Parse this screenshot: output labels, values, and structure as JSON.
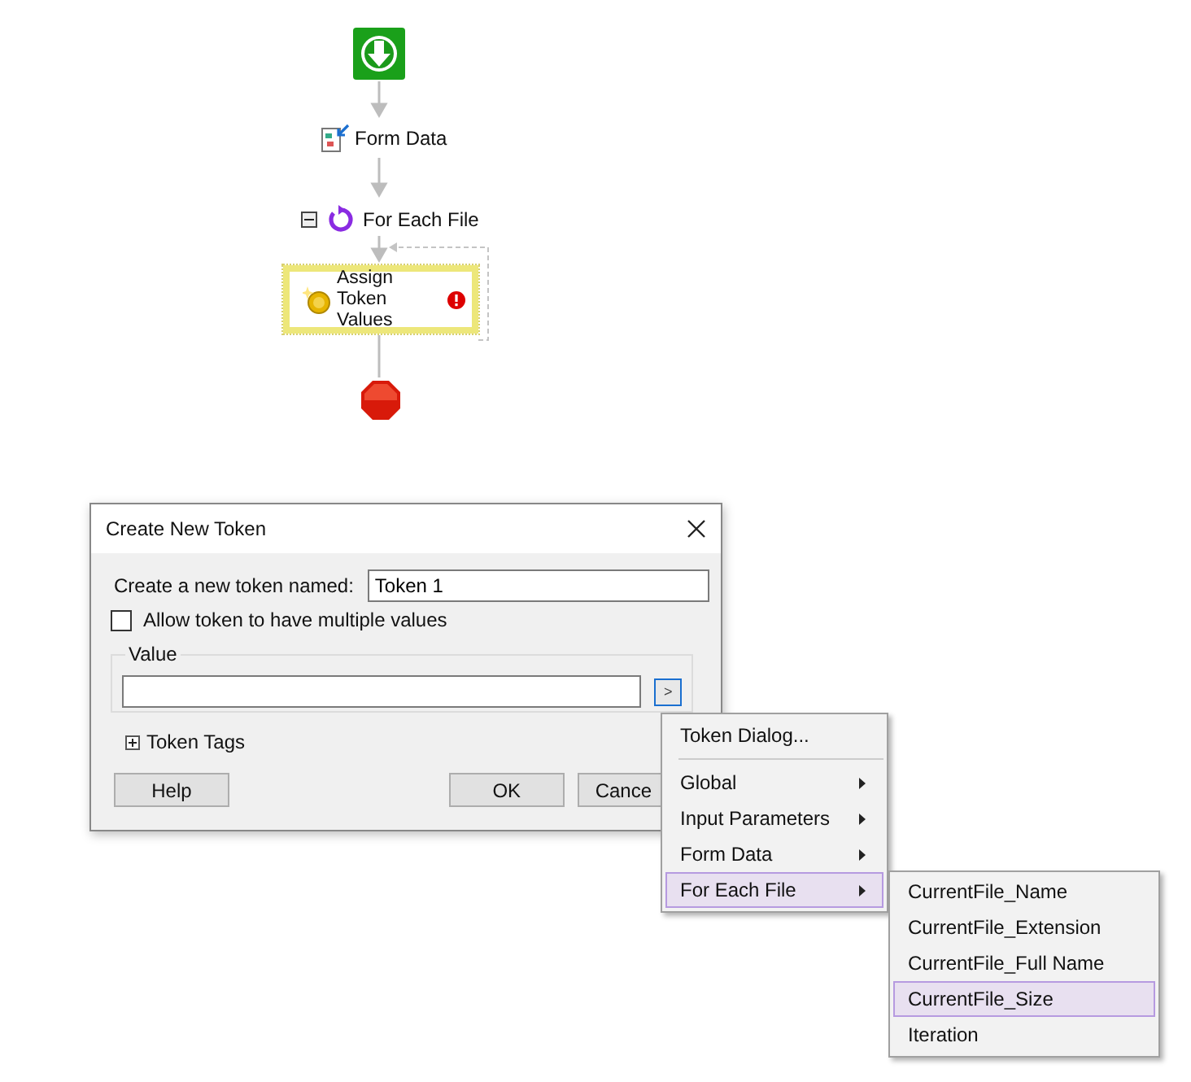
{
  "workflow": {
    "nodes": [
      {
        "kind": "start"
      },
      {
        "kind": "step",
        "label": "Form Data"
      },
      {
        "kind": "loop",
        "label": "For Each File",
        "expanded": true
      },
      {
        "kind": "activity",
        "label": "Assign Token Values",
        "error": true,
        "selected": true
      },
      {
        "kind": "stop"
      }
    ]
  },
  "dialog": {
    "title": "Create New Token",
    "name_label": "Create a new token named:",
    "name_value": "Token 1",
    "allow_multiple": {
      "label": "Allow token to have multiple values",
      "checked": false
    },
    "value_group": {
      "label": "Value",
      "button_label": ">"
    },
    "token_tags": {
      "label": "Token Tags",
      "expanded": false
    },
    "buttons": [
      "Help",
      "OK",
      "Cance"
    ]
  },
  "menu": {
    "items": [
      {
        "kind": "item",
        "label": "Token Dialog...",
        "selected": false
      },
      {
        "kind": "separator"
      },
      {
        "kind": "submenu",
        "label": "Global",
        "selected": false
      },
      {
        "kind": "submenu",
        "label": "Input Parameters",
        "selected": false
      },
      {
        "kind": "submenu",
        "label": "Form Data",
        "selected": false
      },
      {
        "kind": "submenu",
        "label": "For Each File",
        "selected": true
      }
    ]
  },
  "submenu": {
    "items": [
      {
        "label": "CurrentFile_Name",
        "selected": false
      },
      {
        "label": "CurrentFile_Extension",
        "selected": false
      },
      {
        "label": "CurrentFile_Full Name",
        "selected": false
      },
      {
        "label": "CurrentFile_Size",
        "selected": true
      },
      {
        "label": "Iteration",
        "selected": false
      }
    ]
  }
}
